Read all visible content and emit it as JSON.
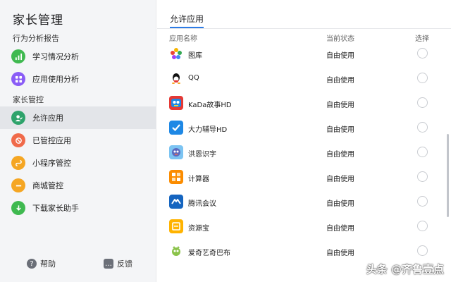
{
  "sidebar": {
    "title": "家长管理",
    "section1": "行为分析报告",
    "section2": "家长管控",
    "items": [
      {
        "label": "学习情况分析",
        "icon": "chart-icon",
        "color": "#3fb950"
      },
      {
        "label": "应用使用分析",
        "icon": "grid-icon",
        "color": "#8a5cf6"
      },
      {
        "label": "允许应用",
        "icon": "person-check-icon",
        "color": "#2ea36b"
      },
      {
        "label": "已管控应用",
        "icon": "ban-icon",
        "color": "#f06a4a"
      },
      {
        "label": "小程序管控",
        "icon": "mini-program-icon",
        "color": "#f5a623"
      },
      {
        "label": "商城管控",
        "icon": "minus-icon",
        "color": "#f5a623"
      },
      {
        "label": "下载家长助手",
        "icon": "download-icon",
        "color": "#3fb950"
      }
    ],
    "footer": {
      "help": "帮助",
      "feedback": "反馈"
    }
  },
  "main": {
    "title": "允许应用",
    "columns": {
      "name": "应用名称",
      "status": "当前状态",
      "select": "选择"
    },
    "rows": [
      {
        "name": "图库",
        "status": "自由使用",
        "icon": "gallery-icon"
      },
      {
        "name": "QQ",
        "status": "自由使用",
        "icon": "qq-icon"
      },
      {
        "name": "KaDa故事HD",
        "status": "自由使用",
        "icon": "kada-icon"
      },
      {
        "name": "大力辅导HD",
        "status": "自由使用",
        "icon": "dali-icon"
      },
      {
        "name": "洪恩识字",
        "status": "自由使用",
        "icon": "hongen-icon"
      },
      {
        "name": "计算器",
        "status": "自由使用",
        "icon": "calculator-icon"
      },
      {
        "name": "腾讯会议",
        "status": "自由使用",
        "icon": "tencent-meeting-icon"
      },
      {
        "name": "资源宝",
        "status": "自由使用",
        "icon": "resource-icon"
      },
      {
        "name": "爱奇艺奇巴布",
        "status": "自由使用",
        "icon": "qibabu-icon"
      }
    ]
  },
  "watermark": "头条 @齐鲁壹点",
  "colors": {
    "accent": "#2c7be5",
    "active_bg": "#e3e5e9"
  }
}
